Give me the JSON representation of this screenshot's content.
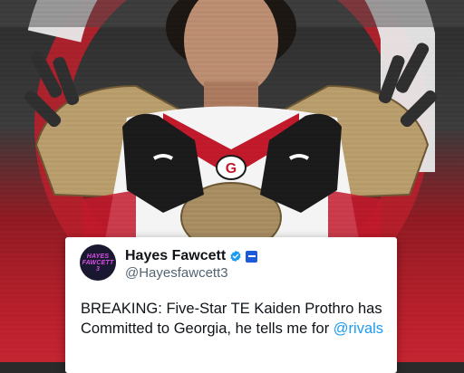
{
  "tweet": {
    "avatar_lines": [
      "HAYES",
      "FAWCETT",
      "3"
    ],
    "display_name": "Hayes Fawcett",
    "handle": "@Hayesfawcett3",
    "text_main": "BREAKING: Five-Star TE Kaiden Prothro has Committed to Georgia, he tells me for ",
    "mention": "@rivals"
  },
  "colors": {
    "georgia_red": "#ba0c2f",
    "twitter_blue": "#1d9bf0",
    "avatar_purple": "#d84fe6"
  },
  "icons": [
    "verified-check-icon",
    "organization-badge-icon",
    "georgia-g-logo-icon"
  ]
}
